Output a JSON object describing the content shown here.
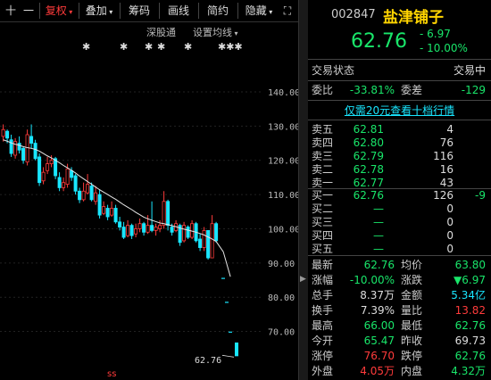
{
  "toolbar": {
    "items": [
      {
        "label": "十"
      },
      {
        "label": "一"
      },
      {
        "label": "复权"
      },
      {
        "label": "叠加"
      },
      {
        "label": "筹码"
      },
      {
        "label": "画线"
      },
      {
        "label": "简约"
      },
      {
        "label": "隐藏"
      },
      {
        "label": "⛶"
      }
    ]
  },
  "subbar": {
    "link1": "深股通",
    "link2": "设置均线"
  },
  "markers": [
    "✱",
    "✱",
    "✱",
    "✱",
    "✱",
    "✱✱✱"
  ],
  "chart": {
    "price_label": "62.76",
    "bottom_marker": "ss"
  },
  "chart_data": {
    "type": "candlestick",
    "y_axis_ticks": [
      "140.00",
      "130.00",
      "120.00",
      "110.00",
      "100.00",
      "90.00",
      "80.00",
      "70.00"
    ],
    "ylim": [
      60.5,
      146
    ],
    "last_price": 62.76,
    "candles": [
      {
        "o": 127.0,
        "c": 129.0,
        "h": 130.5,
        "l": 125.5
      },
      {
        "o": 128.5,
        "c": 126.5,
        "h": 129.0,
        "l": 125.0
      },
      {
        "o": 126.0,
        "c": 122.0,
        "h": 127.5,
        "l": 121.0
      },
      {
        "o": 121.5,
        "c": 125.5,
        "h": 126.5,
        "l": 120.5
      },
      {
        "o": 125.0,
        "c": 123.0,
        "h": 127.0,
        "l": 122.0
      },
      {
        "o": 123.5,
        "c": 120.0,
        "h": 124.0,
        "l": 119.0
      },
      {
        "o": 119.5,
        "c": 127.5,
        "h": 129.0,
        "l": 118.5
      },
      {
        "o": 127.0,
        "c": 125.0,
        "h": 130.5,
        "l": 123.5
      },
      {
        "o": 125.0,
        "c": 120.5,
        "h": 126.0,
        "l": 120.0
      },
      {
        "o": 121.0,
        "c": 113.5,
        "h": 122.0,
        "l": 112.5
      },
      {
        "o": 114.0,
        "c": 116.5,
        "h": 118.0,
        "l": 113.0
      },
      {
        "o": 117.0,
        "c": 119.0,
        "h": 121.0,
        "l": 116.0
      },
      {
        "o": 119.0,
        "c": 120.0,
        "h": 121.5,
        "l": 118.0
      },
      {
        "o": 120.5,
        "c": 115.5,
        "h": 121.0,
        "l": 114.5
      },
      {
        "o": 115.0,
        "c": 112.0,
        "h": 116.5,
        "l": 111.0
      },
      {
        "o": 112.0,
        "c": 113.5,
        "h": 115.0,
        "l": 111.0
      },
      {
        "o": 113.0,
        "c": 117.5,
        "h": 119.0,
        "l": 112.0
      },
      {
        "o": 117.0,
        "c": 115.0,
        "h": 118.0,
        "l": 114.0
      },
      {
        "o": 115.5,
        "c": 111.0,
        "h": 116.0,
        "l": 110.0
      },
      {
        "o": 111.0,
        "c": 108.5,
        "h": 112.0,
        "l": 107.5
      },
      {
        "o": 108.5,
        "c": 111.0,
        "h": 113.5,
        "l": 108.0
      },
      {
        "o": 110.5,
        "c": 113.0,
        "h": 116.0,
        "l": 110.0
      },
      {
        "o": 112.5,
        "c": 108.5,
        "h": 113.5,
        "l": 108.0
      },
      {
        "o": 108.0,
        "c": 110.5,
        "h": 112.5,
        "l": 107.0
      },
      {
        "o": 110.0,
        "c": 104.0,
        "h": 111.5,
        "l": 103.0
      },
      {
        "o": 104.5,
        "c": 106.5,
        "h": 108.0,
        "l": 104.0
      },
      {
        "o": 106.0,
        "c": 103.5,
        "h": 107.0,
        "l": 102.5
      },
      {
        "o": 104.0,
        "c": 106.0,
        "h": 108.0,
        "l": 103.5
      },
      {
        "o": 106.0,
        "c": 102.0,
        "h": 107.0,
        "l": 101.5
      },
      {
        "o": 102.0,
        "c": 100.5,
        "h": 103.5,
        "l": 99.5
      },
      {
        "o": 100.5,
        "c": 97.5,
        "h": 102.0,
        "l": 97.0
      },
      {
        "o": 98.0,
        "c": 101.0,
        "h": 102.5,
        "l": 97.5
      },
      {
        "o": 101.0,
        "c": 98.0,
        "h": 101.5,
        "l": 97.0
      },
      {
        "o": 98.5,
        "c": 100.0,
        "h": 101.5,
        "l": 97.5
      },
      {
        "o": 100.0,
        "c": 101.5,
        "h": 103.0,
        "l": 99.0
      },
      {
        "o": 101.5,
        "c": 99.0,
        "h": 102.0,
        "l": 98.0
      },
      {
        "o": 99.0,
        "c": 101.0,
        "h": 104.0,
        "l": 98.5
      },
      {
        "o": 101.0,
        "c": 99.5,
        "h": 108.0,
        "l": 99.0
      },
      {
        "o": 99.5,
        "c": 100.5,
        "h": 101.5,
        "l": 98.0
      },
      {
        "o": 100.0,
        "c": 101.0,
        "h": 102.5,
        "l": 99.0
      },
      {
        "o": 101.0,
        "c": 108.0,
        "h": 111.0,
        "l": 100.0
      },
      {
        "o": 108.0,
        "c": 101.0,
        "h": 108.5,
        "l": 99.5
      },
      {
        "o": 100.5,
        "c": 99.0,
        "h": 101.5,
        "l": 98.0
      },
      {
        "o": 99.5,
        "c": 101.5,
        "h": 102.5,
        "l": 99.0
      },
      {
        "o": 101.0,
        "c": 96.0,
        "h": 101.5,
        "l": 95.0
      },
      {
        "o": 96.5,
        "c": 101.0,
        "h": 102.0,
        "l": 96.0
      },
      {
        "o": 100.5,
        "c": 97.5,
        "h": 101.0,
        "l": 97.0
      },
      {
        "o": 97.5,
        "c": 101.5,
        "h": 102.5,
        "l": 97.0
      },
      {
        "o": 101.5,
        "c": 96.5,
        "h": 102.0,
        "l": 96.0
      },
      {
        "o": 97.0,
        "c": 94.5,
        "h": 98.5,
        "l": 93.5
      },
      {
        "o": 94.5,
        "c": 99.5,
        "h": 100.5,
        "l": 93.5
      },
      {
        "o": 99.5,
        "c": 91.5,
        "h": 99.5,
        "l": 91.0
      },
      {
        "o": 91.5,
        "c": 101.5,
        "h": 104.0,
        "l": 91.5
      },
      {
        "o": 101.5,
        "c": 96.5,
        "h": 102.0,
        "l": 96.0
      }
    ],
    "ma": [
      126,
      125.6,
      125.1,
      124.7,
      124.4,
      124,
      123.7,
      123.5,
      123.2,
      122.7,
      122,
      121.3,
      120.7,
      120,
      119.3,
      118.5,
      117.8,
      117.1,
      116.3,
      115.4,
      114.6,
      113.8,
      113,
      112.2,
      111.4,
      110.7,
      110,
      109.3,
      108.6,
      107.8,
      107,
      106.3,
      105.6,
      104.8,
      104.1,
      103.4,
      102.9,
      102.5,
      102.1,
      101.7,
      101.5,
      101.2,
      100.9,
      100.6,
      100.2,
      99.9,
      99.6,
      99.3,
      99,
      98.6,
      98.2,
      97.6,
      97,
      96.3
    ],
    "tail_ma": [
      [
        95.5,
        93.3
      ],
      [
        91.5,
        86.0
      ]
    ],
    "tail_ticks": [
      85.5,
      78.5,
      69.8
    ]
  },
  "stock": {
    "code": "002847",
    "name": "盐津铺子",
    "price": "62.76",
    "change": "- 6.97",
    "change_pct": "- 10.00%"
  },
  "status": {
    "label": "交易状态",
    "value": "交易中"
  },
  "ratio": {
    "l1": "委比",
    "v1": "-33.81%",
    "l2": "委差",
    "v2": "-129"
  },
  "promo": "仅需20元查看十档行情",
  "sell": [
    {
      "label": "卖五",
      "price": "62.81",
      "vol": "4"
    },
    {
      "label": "卖四",
      "price": "62.80",
      "vol": "76"
    },
    {
      "label": "卖三",
      "price": "62.79",
      "vol": "116"
    },
    {
      "label": "卖二",
      "price": "62.78",
      "vol": "16"
    },
    {
      "label": "卖一",
      "price": "62.77",
      "vol": "43"
    }
  ],
  "buy": [
    {
      "label": "买一",
      "price": "62.76",
      "vol": "126",
      "delta": "-9"
    },
    {
      "label": "买二",
      "price": "—",
      "vol": "0",
      "delta": ""
    },
    {
      "label": "买三",
      "price": "—",
      "vol": "0",
      "delta": ""
    },
    {
      "label": "买四",
      "price": "—",
      "vol": "0",
      "delta": ""
    },
    {
      "label": "买五",
      "price": "—",
      "vol": "0",
      "delta": ""
    }
  ],
  "stats": [
    {
      "l1": "最新",
      "v1": "62.76",
      "c1": "g",
      "l2": "均价",
      "v2": "63.80",
      "c2": "g"
    },
    {
      "l1": "涨幅",
      "v1": "-10.00%",
      "c1": "g",
      "l2": "涨跌",
      "v2": "▼6.97",
      "c2": "g"
    },
    {
      "l1": "总手",
      "v1": "8.37万",
      "c1": "w",
      "l2": "金额",
      "v2": "5.34亿",
      "c2": "c"
    },
    {
      "l1": "换手",
      "v1": "7.39%",
      "c1": "w",
      "l2": "量比",
      "v2": "13.82",
      "c2": "r"
    },
    {
      "l1": "最高",
      "v1": "66.00",
      "c1": "g",
      "l2": "最低",
      "v2": "62.76",
      "c2": "g"
    },
    {
      "l1": "今开",
      "v1": "65.47",
      "c1": "g",
      "l2": "昨收",
      "v2": "69.73",
      "c2": "w"
    },
    {
      "l1": "涨停",
      "v1": "76.70",
      "c1": "r",
      "l2": "跌停",
      "v2": "62.76",
      "c2": "g"
    },
    {
      "l1": "外盘",
      "v1": "4.05万",
      "c1": "r",
      "l2": "内盘",
      "v2": "4.32万",
      "c2": "g"
    }
  ],
  "colors": {
    "up": "#ff3b3b",
    "down": "#19e6ff",
    "ma": "#e6e6e6",
    "highlight": "#ffd400",
    "fall": "#19e66a"
  }
}
